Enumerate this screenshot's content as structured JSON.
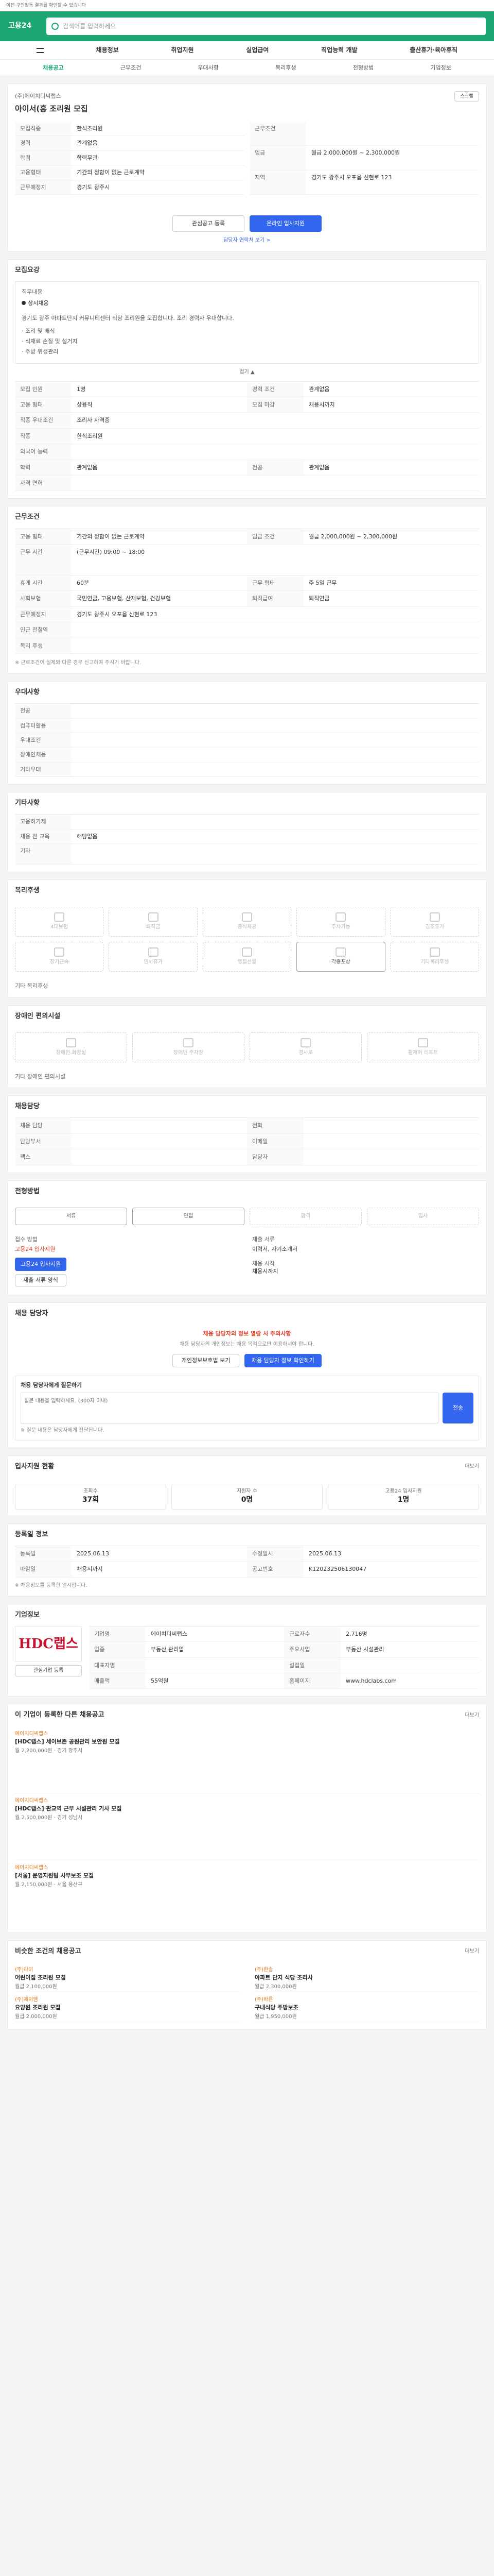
{
  "top": {
    "notice": "이전 구인활동 결과를 확인할 수 있습니다",
    "logo": "고용24",
    "search": "검색어를 입력하세요"
  },
  "nav": [
    "채용정보",
    "취업지원",
    "실업급여",
    "직업능력 개발",
    "출산휴가·육아휴직"
  ],
  "tabs": [
    "채용공고",
    "근무조건",
    "우대사항",
    "복리후생",
    "전형방법",
    "기업정보"
  ],
  "job": {
    "company": "(주)에이치디씨랩스",
    "title": "아이서(흥 조리원 모집",
    "share_btn": "스크랩",
    "k": [
      "모집직종",
      "경력",
      "학력"
    ],
    "v": [
      "한식조리원",
      "관계없음",
      "학력무관"
    ],
    "k2": [
      "근무조건",
      "임금",
      "지역"
    ],
    "v2": [
      "",
      "월급 2,000,000원 ~ 2,300,000원",
      "경기도 광주시 오포읍 신현로 123"
    ],
    "k3": [
      "고용형태",
      "근무예정지"
    ],
    "v3": [
      "기간의 정함이 없는 근로계약",
      "경기도 광주시"
    ],
    "apply_btn": "온라인 입사지원",
    "fav_btn": "관심공고 등록",
    "link": "담당자 연락처 보기 >"
  },
  "recruit": {
    "title": "모집요강",
    "type": "직무내용",
    "check": "상시채용",
    "desc": "경기도 광주 아파트단지 커뮤니티센터 식당 조리원을 모집합니다. 조리 경력자 우대합니다.",
    "items": [
      "조리 및 배식",
      "식재료 손질 및 설거지",
      "주방 위생관리"
    ],
    "fold": "접기 ▲",
    "rows": [
      [
        "모집 인원",
        "1명",
        "경력 조건",
        "관계없음"
      ],
      [
        "고용 형태",
        "상용직",
        "모집 마감",
        "채용시까지"
      ],
      [
        "직종 우대조건",
        "조리사 자격증",
        "",
        "",
        ""
      ],
      [
        "직종",
        "한식조리원",
        "",
        "",
        ""
      ],
      [
        "외국어 능력",
        "",
        "",
        "",
        ""
      ],
      [
        "학력",
        "관계없음",
        "전공",
        "관계없음"
      ],
      [
        "자격 면허",
        "",
        "",
        "",
        ""
      ]
    ]
  },
  "cond": {
    "title": "근무조건",
    "rows": [
      [
        "고용 형태",
        "기간의 정함이 없는 근로계약",
        "임금 조건",
        "월급 2,000,000원 ~ 2,300,000원"
      ],
      [
        "근무 시간",
        "(근무시간) 09:00 ~ 18:00",
        "",
        ""
      ],
      [
        "휴게 시간",
        "60분",
        "근무 형태",
        "주 5일 근무"
      ],
      [
        "사회보험",
        "국민연금, 고용보험, 산재보험, 건강보험",
        "퇴직급여",
        "퇴직연금"
      ],
      [
        "근무예정지",
        "경기도 광주시 오포읍 신현로 123",
        "",
        ""
      ],
      [
        "인근 전철역",
        "",
        "",
        ""
      ],
      [
        "복리 후생",
        "",
        "",
        ""
      ]
    ],
    "note": "※ 근로조건이 실제와 다른 경우 신고하여 주시기 바랍니다."
  },
  "pref": {
    "title": "우대사항",
    "k": [
      "전공",
      "컴퓨터활용",
      "우대조건",
      "장애인채용",
      "기타우대"
    ],
    "v": [
      "",
      "",
      "",
      "",
      ""
    ]
  },
  "etc": {
    "title": "기타사항",
    "k": [
      "고용허가제",
      "채용 전 교육",
      "기타"
    ],
    "v": [
      "",
      "해당없음",
      ""
    ]
  },
  "welfare": {
    "title": "복리후생",
    "items": [
      "4대보험",
      "퇴직금",
      "중식제공",
      "주차가능",
      "경조휴가",
      "장기근속",
      "연차휴가",
      "명절선물",
      "각종포상",
      "기타복리후생"
    ],
    "etc_label": "기타 복리후생"
  },
  "disabled": {
    "title": "장애인 편의시설",
    "items": [
      "장애인 화장실",
      "장애인 주차장",
      "경사로",
      "휠체어 리프트"
    ],
    "etc_label": "기타 장애인 편의시설"
  },
  "corp": {
    "title": "채용담당",
    "k": [
      "채용 담당",
      "전화",
      "담당부서",
      "이메일",
      "팩스",
      "담당자"
    ],
    "v": [
      "",
      "",
      "",
      "",
      "",
      ""
    ]
  },
  "method": {
    "title": "전형방법",
    "steps": [
      "서류",
      "면접",
      "합격",
      "입사"
    ],
    "submit_k": "접수 방법",
    "submit_v": "고용24 입사지원",
    "submit_btn": "고용24 입사지원",
    "docs_btn": "제출 서류 양식",
    "docs_k": "제출 서류",
    "docs_v": "이력서, 자기소개서",
    "period_k": "채용 시작",
    "period_v": "채용시까지"
  },
  "contact": {
    "title": "채용 담당자",
    "warn": "채용 담당자의 정보 열람 시 주의사항",
    "text": "채용 담당자의 개인정보는 채용 목적으로만 이용하셔야 합니다.",
    "btn1": "개인정보보호법 보기",
    "btn2": "채용 담당자 정보 확인하기",
    "qa_title": "채용 담당자에게 질문하기",
    "qa_placeholder": "질문 내용을 입력하세요. (300자 이내)",
    "qa_btn": "전송",
    "qa_note": "※ 질문 내용은 담당자에게 전달됩니다."
  },
  "status": {
    "title": "입사지원 현황",
    "more": "더보기",
    "items": [
      [
        "조회수",
        "37회"
      ],
      [
        "지원자 수",
        "0명"
      ],
      [
        "고용24 입사지원",
        "1명"
      ]
    ]
  },
  "reg": {
    "title": "등록일 정보",
    "rows": [
      [
        "등록일",
        "2025.06.13",
        "수정일시",
        "2025.06.13"
      ],
      [
        "마감일",
        "채용시까지",
        "공고번호",
        "K120232506130047"
      ]
    ],
    "note": "※ 채용정보를 등록한 일시입니다."
  },
  "company": {
    "title": "기업정보",
    "logo_text": "HDC랩스",
    "btn": "관심기업 등록",
    "k": [
      "기업명",
      "업종",
      "대표자명",
      "매출액"
    ],
    "v": [
      "에이치디씨랩스",
      "부동산 관리업",
      "",
      "55억원"
    ],
    "k2": [
      "근로자수",
      "주요사업",
      "설립일",
      "홈페이지"
    ],
    "v2": [
      "2,716명",
      "부동산 시설관리",
      "",
      "www.hdclabs.com"
    ]
  },
  "recommend": {
    "title": "이 기업이 등록한 다른 채용공고",
    "more": "더보기",
    "jobs": [
      {
        "corp": "에이치디씨랩스",
        "title": "[HDC랩스] 세이브존 공원관리 보안원 모집",
        "pay": "월 2,200,000원 · 경기 광주시"
      },
      {
        "corp": "에이치디씨랩스",
        "title": "[HDC랩스] 판교역 근무 시설관리 기사 모집",
        "pay": "월 2,500,000원 · 경기 성남시"
      },
      {
        "corp": "에이치디씨랩스",
        "title": "[서울] 운영지원팀 사무보조 모집",
        "pay": "월 2,150,000원 · 서울 용산구"
      }
    ]
  },
  "similar": {
    "title": "비슷한 조건의 채용공고",
    "more": "더보기",
    "jobs": [
      {
        "corp": "(주)라미",
        "title": "어린이집 조리원 모집",
        "pay": "월급 2,100,000원"
      },
      {
        "corp": "(주)한솔",
        "title": "아파트 단지 식당 조리사",
        "pay": "월급 2,300,000원"
      },
      {
        "corp": "(주)제이엠",
        "title": "요양원 조리원 모집",
        "pay": "월급 2,000,000원"
      },
      {
        "corp": "(주)바른",
        "title": "구내식당 주방보조",
        "pay": "월급 1,950,000원"
      }
    ]
  }
}
